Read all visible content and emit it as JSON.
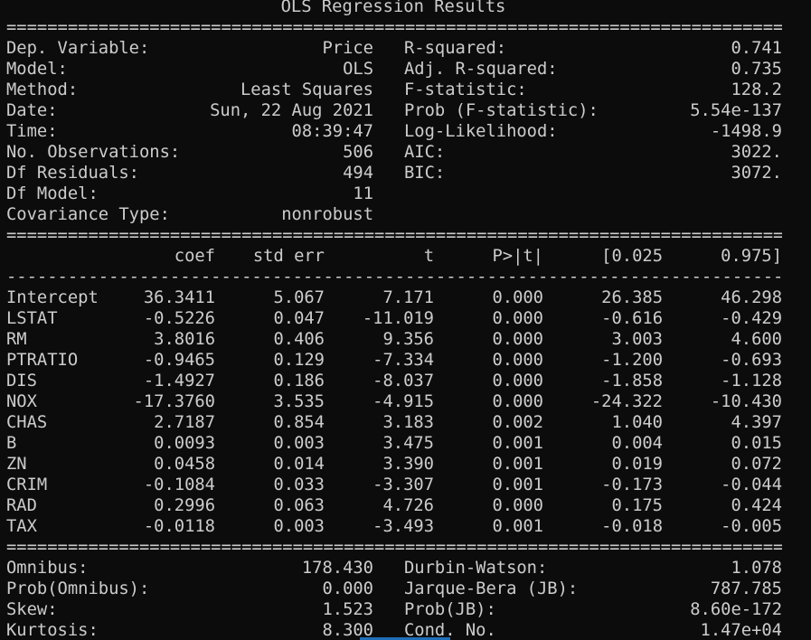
{
  "title": "OLS Regression Results",
  "separators": {
    "double": "===================================================================================================",
    "single": "---------------------------------------------------------------------------------------------------"
  },
  "summary_left": [
    {
      "label": "Dep. Variable:",
      "value": "Price"
    },
    {
      "label": "Model:",
      "value": "OLS"
    },
    {
      "label": "Method:",
      "value": "Least Squares"
    },
    {
      "label": "Date:",
      "value": "Sun, 22 Aug 2021"
    },
    {
      "label": "Time:",
      "value": "08:39:47"
    },
    {
      "label": "No. Observations:",
      "value": "506"
    },
    {
      "label": "Df Residuals:",
      "value": "494"
    },
    {
      "label": "Df Model:",
      "value": "11"
    },
    {
      "label": "Covariance Type:",
      "value": "nonrobust"
    }
  ],
  "summary_right": [
    {
      "label": "R-squared:",
      "value": "0.741"
    },
    {
      "label": "Adj. R-squared:",
      "value": "0.735"
    },
    {
      "label": "F-statistic:",
      "value": "128.2"
    },
    {
      "label": "Prob (F-statistic):",
      "value": "5.54e-137"
    },
    {
      "label": "Log-Likelihood:",
      "value": "-1498.9"
    },
    {
      "label": "AIC:",
      "value": "3022."
    },
    {
      "label": "BIC:",
      "value": "3072."
    }
  ],
  "coef_headers": [
    "coef",
    "std err",
    "t",
    "P>|t|",
    "[0.025",
    "0.975]"
  ],
  "coef_rows": [
    [
      "Intercept",
      "36.3411",
      "5.067",
      "7.171",
      "0.000",
      "26.385",
      "46.298"
    ],
    [
      "LSTAT",
      "-0.5226",
      "0.047",
      "-11.019",
      "0.000",
      "-0.616",
      "-0.429"
    ],
    [
      "RM",
      "3.8016",
      "0.406",
      "9.356",
      "0.000",
      "3.003",
      "4.600"
    ],
    [
      "PTRATIO",
      "-0.9465",
      "0.129",
      "-7.334",
      "0.000",
      "-1.200",
      "-0.693"
    ],
    [
      "DIS",
      "-1.4927",
      "0.186",
      "-8.037",
      "0.000",
      "-1.858",
      "-1.128"
    ],
    [
      "NOX",
      "-17.3760",
      "3.535",
      "-4.915",
      "0.000",
      "-24.322",
      "-10.430"
    ],
    [
      "CHAS",
      "2.7187",
      "0.854",
      "3.183",
      "0.002",
      "1.040",
      "4.397"
    ],
    [
      "B",
      "0.0093",
      "0.003",
      "3.475",
      "0.001",
      "0.004",
      "0.015"
    ],
    [
      "ZN",
      "0.0458",
      "0.014",
      "3.390",
      "0.001",
      "0.019",
      "0.072"
    ],
    [
      "CRIM",
      "-0.1084",
      "0.033",
      "-3.307",
      "0.001",
      "-0.173",
      "-0.044"
    ],
    [
      "RAD",
      "0.2996",
      "0.063",
      "4.726",
      "0.000",
      "0.175",
      "0.424"
    ],
    [
      "TAX",
      "-0.0118",
      "0.003",
      "-3.493",
      "0.001",
      "-0.018",
      "-0.005"
    ]
  ],
  "diag_left": [
    {
      "label": "Omnibus:",
      "value": "178.430"
    },
    {
      "label": "Prob(Omnibus):",
      "value": "0.000"
    },
    {
      "label": "Skew:",
      "value": "1.523"
    },
    {
      "label": "Kurtosis:",
      "value": "8.300"
    }
  ],
  "diag_right": [
    {
      "label": "Durbin-Watson:",
      "value": "1.078"
    },
    {
      "label": "Jarque-Bera (JB):",
      "value": "787.785"
    },
    {
      "label": "Prob(JB):",
      "value": "8.60e-172"
    },
    {
      "label": "Cond. No.",
      "value": "1.47e+04"
    }
  ],
  "colors": {
    "background": "#0c0c0c",
    "foreground": "#cccccc",
    "accent": "#1e6fb8"
  }
}
